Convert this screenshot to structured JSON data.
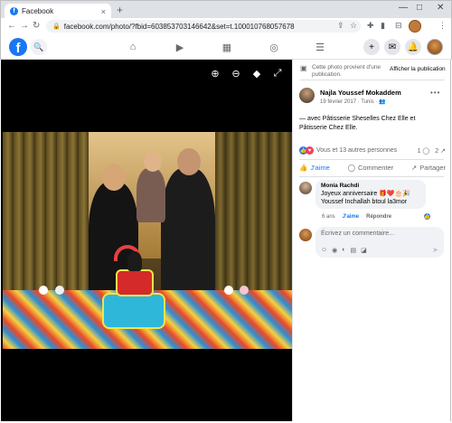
{
  "browser": {
    "tab_title": "Facebook",
    "tab_close": "×",
    "new_tab": "+",
    "url": "facebook.com/photo/?fbid=603853703146642&set=t.100010768057678",
    "win_minimize": "—",
    "win_maximize": "□",
    "win_close": "✕",
    "back": "←",
    "forward": "→",
    "reload": "↻",
    "lock": "🔒",
    "share_icon": "⇪",
    "star_icon": "☆",
    "puzzle_icon": "✚",
    "sidebar_icon": "▮",
    "menu_icon": "⋮"
  },
  "fb_header": {
    "logo": "f",
    "search_icon": "🔍",
    "nav": [
      {
        "name": "home",
        "glyph": "⌂"
      },
      {
        "name": "watch",
        "glyph": "▶"
      },
      {
        "name": "marketplace",
        "glyph": "▦"
      },
      {
        "name": "groups",
        "glyph": "◎"
      },
      {
        "name": "menu",
        "glyph": "☰"
      }
    ],
    "create": "+",
    "messenger": "✉",
    "notifications": "🔔"
  },
  "viewer": {
    "zoom_in": "⊕",
    "zoom_out": "⊖",
    "tag": "◆",
    "fullscreen": "⤢"
  },
  "panel": {
    "notice_text": "Cette photo provient d'une publication.",
    "notice_link": "Afficher la publication",
    "author_name": "Najla Youssef Mokaddem",
    "author_meta": "19 février 2017 · Tunis · 👥",
    "more": "•••",
    "post_text": "— avec Pâtisserie Sheselles Chez Elle et Pâtisserie Chez Elle.",
    "reactions_text": "Vous et 13 autres personnes",
    "comments_count": "1",
    "shares_count": "2",
    "actions": {
      "like": "J'aime",
      "comment": "Commenter",
      "share": "Partager"
    },
    "comment": {
      "name": "Monia Rachdi",
      "text": "Joyeux anniversaire 🎁❤️🎂🎉 Youssef Inchallah btoul la3mor",
      "age": "6 ans",
      "like": "J'aime",
      "reply": "Répondre"
    },
    "composer_placeholder": "Écrivez un commentaire…",
    "composer_tools": [
      "☺",
      "◉",
      "◐",
      "▤",
      "◪"
    ],
    "send": "➤"
  }
}
